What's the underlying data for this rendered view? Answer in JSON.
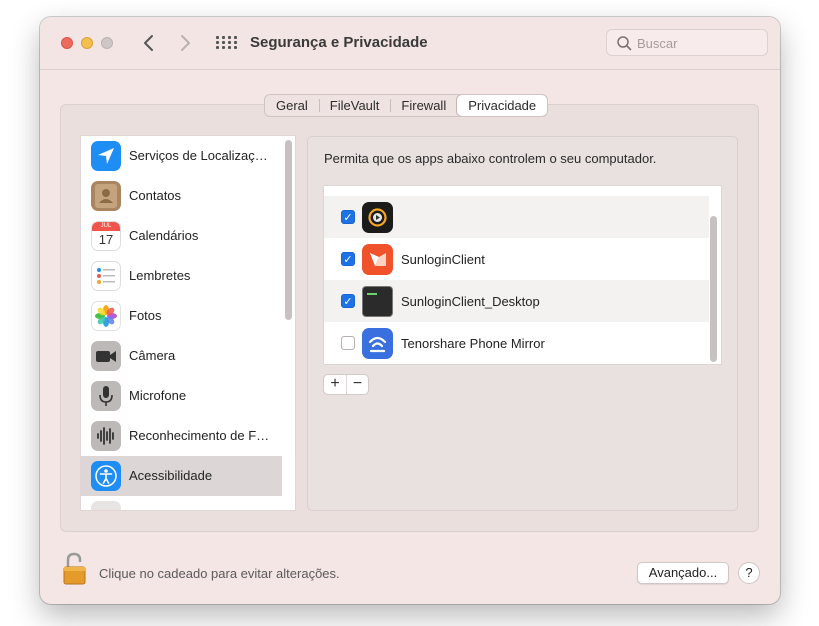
{
  "window": {
    "title": "Segurança e Privacidade",
    "search_placeholder": "Buscar"
  },
  "tabs": [
    {
      "label": "Geral",
      "active": false
    },
    {
      "label": "FileVault",
      "active": false
    },
    {
      "label": "Firewall",
      "active": false
    },
    {
      "label": "Privacidade",
      "active": true
    }
  ],
  "sidebar": {
    "items": [
      {
        "label": "Serviços de Localizaç…",
        "icon": "location-arrow-icon",
        "selected": false
      },
      {
        "label": "Contatos",
        "icon": "contacts-icon",
        "selected": false
      },
      {
        "label": "Calendários",
        "icon": "calendar-icon",
        "selected": false,
        "icon_text": {
          "month": "JUL",
          "day": "17"
        }
      },
      {
        "label": "Lembretes",
        "icon": "reminders-icon",
        "selected": false
      },
      {
        "label": "Fotos",
        "icon": "photos-icon",
        "selected": false
      },
      {
        "label": "Câmera",
        "icon": "camera-icon",
        "selected": false
      },
      {
        "label": "Microfone",
        "icon": "microphone-icon",
        "selected": false
      },
      {
        "label": "Reconhecimento de F…",
        "icon": "speech-recognition-icon",
        "selected": false
      },
      {
        "label": "Acessibilidade",
        "icon": "accessibility-icon",
        "selected": true
      }
    ]
  },
  "panel": {
    "description": "Permita que os apps abaixo controlem o seu computador.",
    "apps": [
      {
        "name": "",
        "checked": true,
        "icon": "camera-app-icon"
      },
      {
        "name": "SunloginClient",
        "checked": true,
        "icon": "sunlogin-icon"
      },
      {
        "name": "SunloginClient_Desktop",
        "checked": true,
        "icon": "terminal-icon"
      },
      {
        "name": "Tenorshare Phone Mirror",
        "checked": false,
        "icon": "phone-mirror-icon"
      }
    ],
    "add_label": "+",
    "remove_label": "−"
  },
  "footer": {
    "lock_text": "Clique no cadeado para evitar alterações.",
    "advanced_label": "Avançado...",
    "help_label": "?"
  },
  "colors": {
    "window_bg": "#f3e6e5",
    "accent": "#1c72e6",
    "selection": "#dcd7d6"
  }
}
